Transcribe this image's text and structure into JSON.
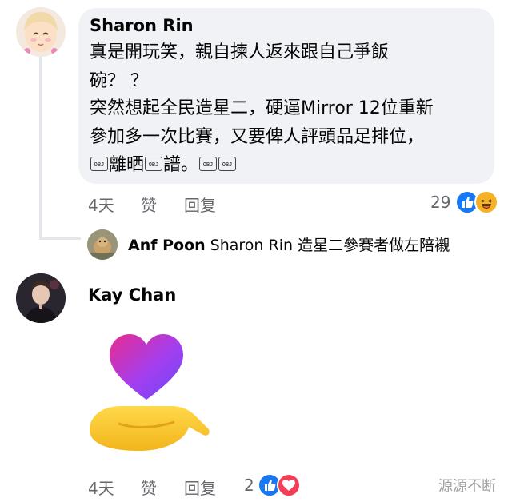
{
  "comment1": {
    "author": "Sharon Rin",
    "lines": [
      "真是開玩笑，親自揀人返來跟自己爭飯",
      "碗？ ？",
      "突然想起全民造星二，硬逼Mirror 12位重新",
      "參加多一次比賽，又要俾人評頭品足排位，"
    ],
    "line5_a": "離晒",
    "line5_b": "譜。",
    "obj_glyph": "OBJ",
    "time": "4天",
    "like": "赞",
    "reply": "回复",
    "reaction_count": "29",
    "reactions": [
      "like-icon",
      "haha-icon"
    ]
  },
  "reply1": {
    "author": "Anf Poon",
    "text": "Sharon Rin 造星二參賽者做左陪襯"
  },
  "comment2": {
    "author": "Kay Chan",
    "sticker": "heart-in-hand-sticker",
    "time": "4天",
    "like": "赞",
    "reply": "回复",
    "reaction_count": "2",
    "reactions": [
      "like-icon",
      "love-icon"
    ]
  },
  "watermark": "源源不断",
  "colors": {
    "bubble": "#f0f2f5",
    "meta": "#65676b",
    "like_blue": "#1877f2",
    "love_red": "#f33e58",
    "haha_yellow": "#f7b125"
  }
}
